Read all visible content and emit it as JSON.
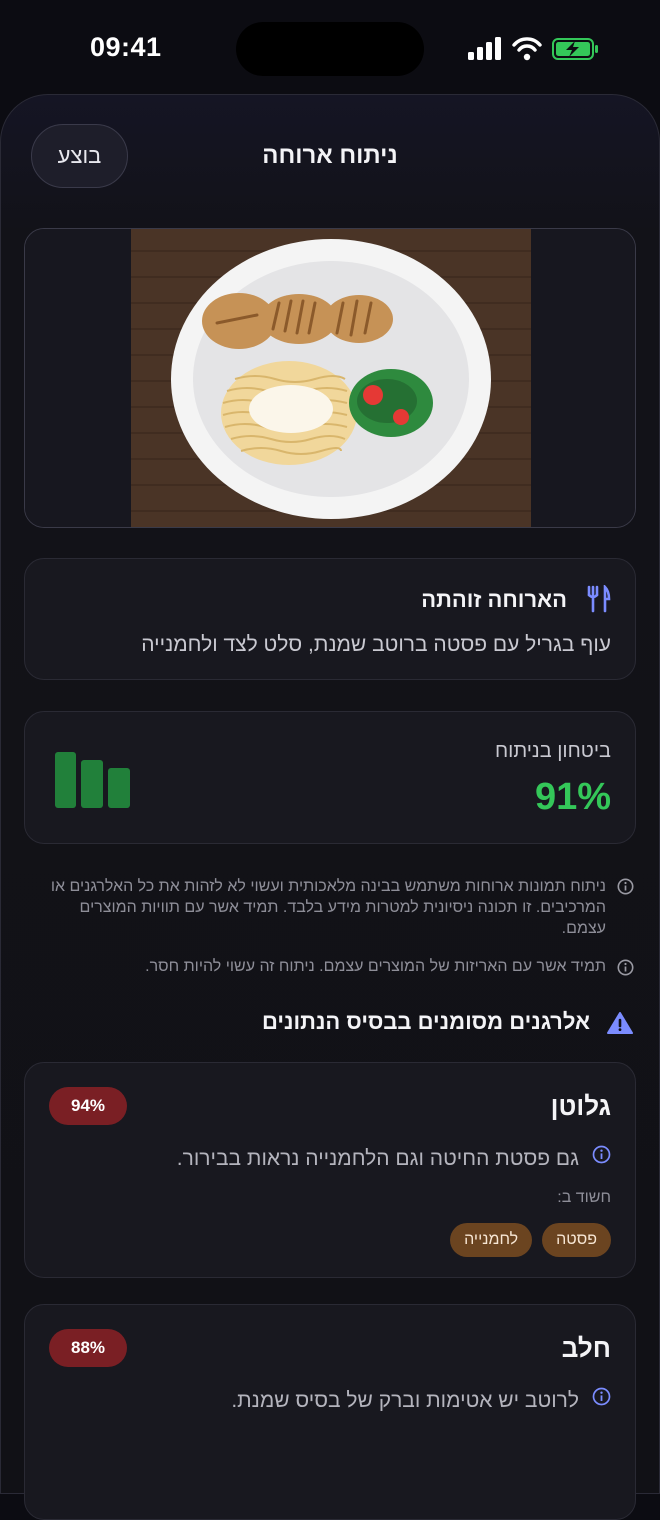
{
  "status": {
    "time": "09:41"
  },
  "nav": {
    "title": "ניתוח ארוחה",
    "done_label": "בוצע"
  },
  "meal": {
    "title": "הארוחה זוהתה",
    "description": "עוף בגריל עם פסטה ברוטב שמנת, סלט לצד ולחמנייה",
    "icon": "fork-knife-icon"
  },
  "confidence": {
    "label": "ביטחון בניתוח",
    "value": "91%",
    "level": 0.91,
    "color": "#34c759"
  },
  "notices": [
    {
      "text": "ניתוח תמונות ארוחות משתמש בבינה מלאכותית ועשוי לא לזהות את כל האלרגנים או המרכיבים. זו תכונה ניסיונית למטרות מידע בלבד. תמיד אשר עם תוויות המוצרים עצמם."
    },
    {
      "text": "תמיד אשר עם האריזות של המוצרים עצמם. ניתוח זה עשוי להיות חסר."
    }
  ],
  "allergens_section": {
    "title": "אלרגנים מסומנים בבסיס הנתונים",
    "icon": "warning-triangle-icon"
  },
  "allergens": [
    {
      "name": "גלוטן",
      "percent": "94%",
      "reason": "גם פסטת החיטה וגם הלחמנייה נראות בבירור.",
      "suspected_label": "חשוד ב:",
      "items": [
        "פסטה",
        "לחמנייה"
      ]
    },
    {
      "name": "חלב",
      "percent": "88%",
      "reason": "לרוטב יש אטימות וברק של בסיס שמנת.",
      "suspected_label": "",
      "items": []
    }
  ],
  "colors": {
    "accent": "#7b8cff",
    "badge": "#7a1f24",
    "chip": "#6b4420",
    "success": "#34c759"
  }
}
